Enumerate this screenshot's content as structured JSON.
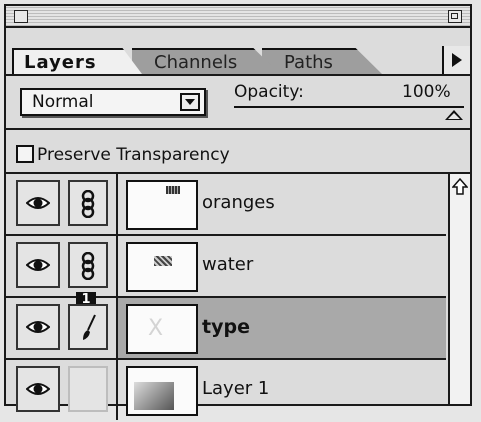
{
  "tabs": {
    "layers": "Layers",
    "channels": "Channels",
    "paths": "Paths"
  },
  "options": {
    "blend_mode": "Normal",
    "opacity_label": "Opacity:",
    "opacity_value": "100%",
    "opacity_fraction": 1.0
  },
  "preserve_transparency": {
    "label": "Preserve Transparency",
    "checked": false
  },
  "layers": [
    {
      "name": "oranges",
      "visible": true,
      "linked": true,
      "selected": false,
      "bold": false
    },
    {
      "name": "water",
      "visible": true,
      "linked": true,
      "selected": false,
      "bold": false
    },
    {
      "name": "type",
      "visible": true,
      "linked": false,
      "selected": true,
      "bold": true,
      "badge": "1"
    },
    {
      "name": "Layer 1",
      "visible": true,
      "linked": false,
      "selected": false,
      "bold": false
    }
  ],
  "icons": {
    "eye": "eye-icon",
    "link": "link-icon",
    "brush": "paintbrush-icon",
    "scroll_up": "arrow-up-icon",
    "menu": "triangle-right-icon"
  }
}
